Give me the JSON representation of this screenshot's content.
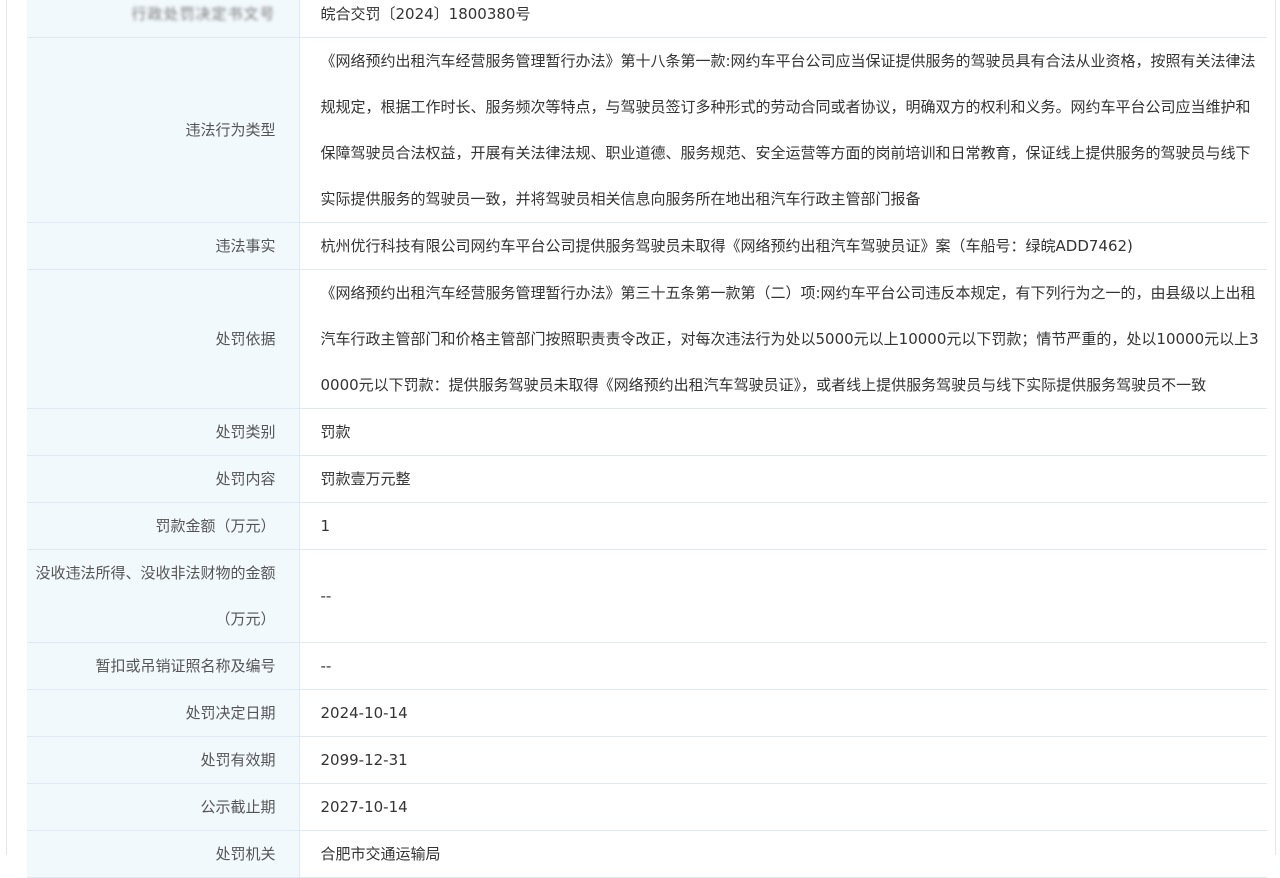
{
  "rows": [
    {
      "key": "decision_no",
      "label": "行政处罚决定书文号",
      "value": "皖合交罚〔2024〕1800380号"
    },
    {
      "key": "violation_type",
      "label": "违法行为类型",
      "value": "《网络预约出租汽车经营服务管理暂行办法》第十八条第一款:网约车平台公司应当保证提供服务的驾驶员具有合法从业资格，按照有关法律法规规定，根据工作时长、服务频次等特点，与驾驶员签订多种形式的劳动合同或者协议，明确双方的权利和义务。网约车平台公司应当维护和保障驾驶员合法权益，开展有关法律法规、职业道德、服务规范、安全运营等方面的岗前培训和日常教育，保证线上提供服务的驾驶员与线下实际提供服务的驾驶员一致，并将驾驶员相关信息向服务所在地出租汽车行政主管部门报备"
    },
    {
      "key": "violation_facts",
      "label": "违法事实",
      "value": "杭州优行科技有限公司网约车平台公司提供服务驾驶员未取得《网络预约出租汽车驾驶员证》案（车船号：绿皖ADD7462)"
    },
    {
      "key": "penalty_basis",
      "label": "处罚依据",
      "value": "《网络预约出租汽车经营服务管理暂行办法》第三十五条第一款第（二）项:网约车平台公司违反本规定，有下列行为之一的，由县级以上出租汽车行政主管部门和价格主管部门按照职责责令改正，对每次违法行为处以5000元以上10000元以下罚款；情节严重的，处以10000元以上30000元以下罚款：提供服务驾驶员未取得《网络预约出租汽车驾驶员证》，或者线上提供服务驾驶员与线下实际提供服务驾驶员不一致"
    },
    {
      "key": "penalty_category",
      "label": "处罚类别",
      "value": "罚款"
    },
    {
      "key": "penalty_content",
      "label": "处罚内容",
      "value": "罚款壹万元整"
    },
    {
      "key": "fine_amount",
      "label": "罚款金额（万元）",
      "value": "1"
    },
    {
      "key": "confiscation_amount",
      "label": "没收违法所得、没收非法财物的金额（万元）",
      "value": "--"
    },
    {
      "key": "license_revoked",
      "label": "暂扣或吊销证照名称及编号",
      "value": "--"
    },
    {
      "key": "decision_date",
      "label": "处罚决定日期",
      "value": "2024-10-14"
    },
    {
      "key": "valid_until",
      "label": "处罚有效期",
      "value": "2099-12-31"
    },
    {
      "key": "publicity_deadline",
      "label": "公示截止期",
      "value": "2027-10-14"
    },
    {
      "key": "authority",
      "label": "处罚机关",
      "value": "合肥市交通运输局"
    }
  ]
}
